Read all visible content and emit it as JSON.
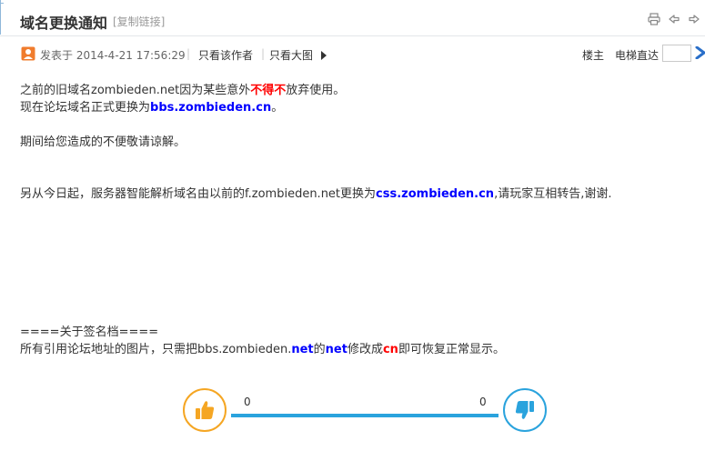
{
  "thread": {
    "title": "域名更换通知",
    "copy_link": "[复制链接]"
  },
  "tools": [
    {
      "icon": "print-icon"
    },
    {
      "icon": "prev-thread-icon"
    },
    {
      "icon": "next-thread-icon"
    }
  ],
  "meta": {
    "posted": "发表于 2014-4-21 17:56:29",
    "sep": "|",
    "only_author": "只看该作者",
    "only_large_images": "只看大图",
    "op": "楼主",
    "jump": "电梯直达",
    "jump_value": ""
  },
  "post": {
    "l1": {
      "a": "之前的旧域名zombieden.net因为某些意外",
      "b": "不得不",
      "c": "放弃使用。"
    },
    "l2": {
      "a": "现在论坛域名正式更换为",
      "b": "bbs.zombieden.cn",
      "c": "。"
    },
    "l3": "期间给您造成的不便敬请谅解。",
    "l4": {
      "a": "另从今日起，服务器智能解析域名由以前的f.zombieden.net更换为",
      "b": "css.zombieden.cn",
      "c": ",请玩家互相转告,谢谢."
    },
    "l5": "====关于签名档====",
    "l6": {
      "a": "所有引用论坛地址的图片，只需把bbs.zombieden.",
      "b": "net",
      "c": "的",
      "d": "net",
      "e": "修改成",
      "f": "cn",
      "g": "即可恢复正常显示。"
    }
  },
  "vote": {
    "up_count": "0",
    "down_count": "0"
  },
  "colors": {
    "accent_blue": "#2aa3dd",
    "accent_orange": "#f5a623",
    "highlight_red": "#ff0000",
    "link_blue": "#0000ff"
  }
}
